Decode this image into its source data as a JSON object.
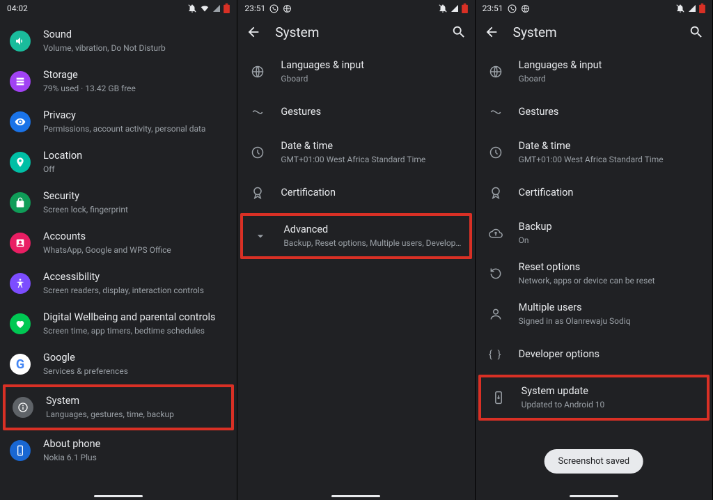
{
  "panel1": {
    "time": "04:02",
    "items": [
      {
        "title": "Sound",
        "sub": "Volume, vibration, Do Not Disturb"
      },
      {
        "title": "Storage",
        "sub": "79% used · 13.42 GB free"
      },
      {
        "title": "Privacy",
        "sub": "Permissions, account activity, personal data"
      },
      {
        "title": "Location",
        "sub": "Off"
      },
      {
        "title": "Security",
        "sub": "Screen lock, fingerprint"
      },
      {
        "title": "Accounts",
        "sub": "WhatsApp, Google and WPS Office"
      },
      {
        "title": "Accessibility",
        "sub": "Screen readers, display, interaction controls"
      },
      {
        "title": "Digital Wellbeing and parental controls",
        "sub": "Screen time, app timers, bedtime schedules"
      },
      {
        "title": "Google",
        "sub": "Services & preferences"
      },
      {
        "title": "System",
        "sub": "Languages, gestures, time, backup"
      },
      {
        "title": "About phone",
        "sub": "Nokia 6.1 Plus"
      }
    ]
  },
  "panel2": {
    "time": "23:51",
    "header": "System",
    "items": [
      {
        "title": "Languages & input",
        "sub": "Gboard"
      },
      {
        "title": "Gestures",
        "sub": ""
      },
      {
        "title": "Date & time",
        "sub": "GMT+01:00 West Africa Standard Time"
      },
      {
        "title": "Certification",
        "sub": ""
      },
      {
        "title": "Advanced",
        "sub": "Backup, Reset options, Multiple users, Developer o…"
      }
    ]
  },
  "panel3": {
    "time": "23:51",
    "header": "System",
    "toast": "Screenshot saved",
    "items": [
      {
        "title": "Languages & input",
        "sub": "Gboard"
      },
      {
        "title": "Gestures",
        "sub": ""
      },
      {
        "title": "Date & time",
        "sub": "GMT+01:00 West Africa Standard Time"
      },
      {
        "title": "Certification",
        "sub": ""
      },
      {
        "title": "Backup",
        "sub": "On"
      },
      {
        "title": "Reset options",
        "sub": "Network, apps or device can be reset"
      },
      {
        "title": "Multiple users",
        "sub": "Signed in as Olanrewaju Sodiq"
      },
      {
        "title": "Developer options",
        "sub": ""
      },
      {
        "title": "System update",
        "sub": "Updated to Android 10"
      }
    ]
  }
}
